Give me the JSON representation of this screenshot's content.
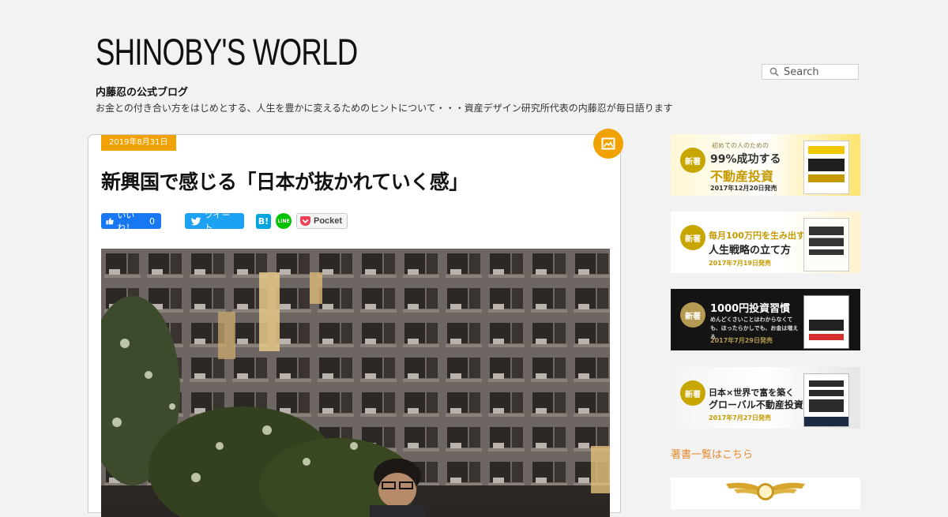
{
  "header": {
    "site_title": "SHINOBY'S WORLD",
    "tagline": "内藤忍の公式ブログ",
    "description": "お金との付き合い方をはじめとする、人生を豊かに変えるためのヒントについて・・・資産デザイン研究所代表の内藤忍が毎日語ります"
  },
  "search": {
    "placeholder": "Search"
  },
  "post": {
    "date": "2019年8月31日",
    "title": "新興国で感じる「日本が抜かれていく感」",
    "share": {
      "facebook_label": "いいね！",
      "facebook_count": "0",
      "twitter_label": "ツイート",
      "hatena_label": "B!",
      "line_label": "LINE",
      "pocket_label": "Pocket"
    }
  },
  "sidebar": {
    "banners": [
      {
        "badge": "新著",
        "subtitle": "初めての人のための",
        "line1": "99%成功する",
        "line2": "不動産投資",
        "date": "2017年12月20日発売"
      },
      {
        "badge": "新著",
        "subtitle": "",
        "line1": "毎月100万円を生み出す",
        "line2": "人生戦略の立て方",
        "date": "2017年7月19日発売"
      },
      {
        "badge": "新著",
        "subtitle": "",
        "line1": "1000円投資習慣",
        "line2": "めんどくさいことはわからなくても、ほったらかしでも、お金は増える",
        "date": "2017年7月29日発売"
      },
      {
        "badge": "新著",
        "subtitle": "",
        "line1": "日本×世界で富を築く",
        "line2": "グローバル不動産投資",
        "date": "2017年7月27日発売"
      }
    ],
    "books_link": "著書一覧はこちら"
  },
  "colors": {
    "accent": "#f2a200",
    "link": "#e8882c",
    "background": "#f2f2f2"
  }
}
